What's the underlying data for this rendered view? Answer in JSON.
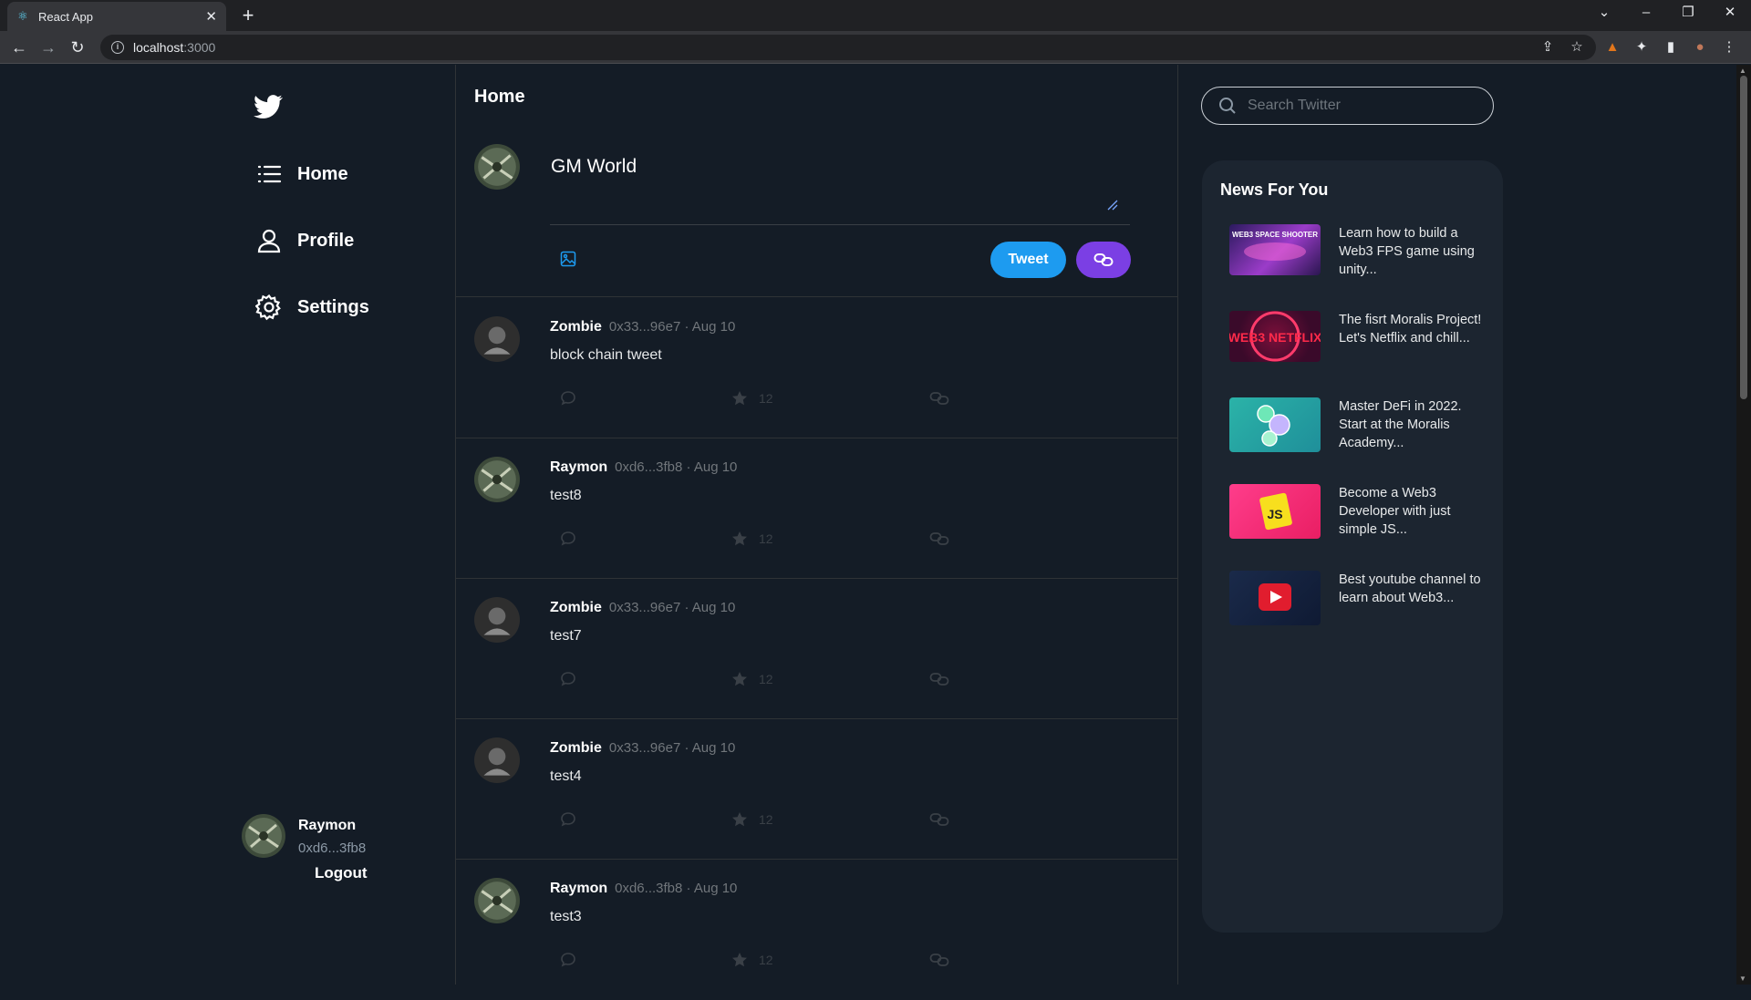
{
  "browser": {
    "tab_title": "React App",
    "url_host": "localhost",
    "url_port": ":3000"
  },
  "sidebar": {
    "items": [
      {
        "label": "Home",
        "icon": "list-icon"
      },
      {
        "label": "Profile",
        "icon": "user-icon"
      },
      {
        "label": "Settings",
        "icon": "gear-icon"
      }
    ],
    "user": {
      "name": "Raymon",
      "address": "0xd6...3fb8"
    },
    "logout_label": "Logout"
  },
  "feed": {
    "title": "Home",
    "composer": {
      "text": "GM World",
      "tweet_label": "Tweet"
    },
    "tweets": [
      {
        "name": "Zombie",
        "meta": "0x33...96e7 · Aug 10",
        "text": "block chain tweet",
        "likes": "12"
      },
      {
        "name": "Raymon",
        "meta": "0xd6...3fb8 · Aug 10",
        "text": "test8",
        "likes": "12"
      },
      {
        "name": "Zombie",
        "meta": "0x33...96e7 · Aug 10",
        "text": "test7",
        "likes": "12"
      },
      {
        "name": "Zombie",
        "meta": "0x33...96e7 · Aug 10",
        "text": "test4",
        "likes": "12"
      },
      {
        "name": "Raymon",
        "meta": "0xd6...3fb8 · Aug 10",
        "text": "test3",
        "likes": "12"
      }
    ]
  },
  "right": {
    "search_placeholder": "Search Twitter",
    "news_title": "News For You",
    "news": [
      {
        "text": "Learn how to build a Web3 FPS game using unity...",
        "thumb_label": "WEB3 SPACE SHOOTER"
      },
      {
        "text": "The fisrt Moralis Project! Let's Netflix and chill...",
        "thumb_label": "WEB3 NETFLIX"
      },
      {
        "text": "Master DeFi in 2022. Start at the Moralis Academy...",
        "thumb_label": ""
      },
      {
        "text": "Become a Web3 Developer with just simple JS...",
        "thumb_label": "JS"
      },
      {
        "text": "Best youtube channel to learn about Web3...",
        "thumb_label": ""
      }
    ]
  },
  "colors": {
    "background": "#141c26",
    "tweet_button": "#1d9bf0",
    "link_button": "#7b3fe4",
    "news_panel": "#1c2530"
  }
}
